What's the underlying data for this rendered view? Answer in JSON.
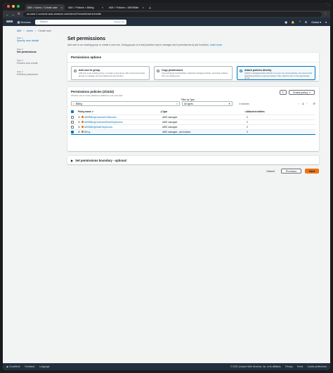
{
  "browser": {
    "tabs": [
      {
        "label": "IAM > Users > Create user",
        "active": true
      },
      {
        "label": "IAM > Policies > Billing",
        "active": false
      },
      {
        "label": "IAM > Policies > AWSBillin",
        "active": false
      }
    ],
    "url": "us-east-1.console.aws.amazon.com/iamv2/home#/users/create"
  },
  "aws_nav": {
    "services": "Services",
    "search_placeholder": "Search",
    "search_shortcut": "[Option+S]",
    "global": "Global",
    "account": "▾"
  },
  "breadcrumb": [
    "IAM",
    "Users",
    "Create user"
  ],
  "steps": [
    {
      "num": "Step 1",
      "label": "Specify user details",
      "state": "done"
    },
    {
      "num": "Step 2",
      "label": "Set permissions",
      "state": "current"
    },
    {
      "num": "Step 3",
      "label": "Review and create",
      "state": "disabled"
    },
    {
      "num": "Step 4",
      "label": "Retrieve password",
      "state": "disabled"
    }
  ],
  "page": {
    "title": "Set permissions",
    "description": "Add user to an existing group or create a new one. Using groups is a best-practice way to manage user's permissions by job functions.",
    "learn_more": "Learn more"
  },
  "permission_options": {
    "title": "Permissions options",
    "options": [
      {
        "title": "Add user to group",
        "desc": "Add user to an existing group, or create a new group. We recommend using groups to manage user permissions by job function.",
        "selected": false
      },
      {
        "title": "Copy permissions",
        "desc": "Copy all group memberships, attached managed policies, and inline policies from an existing user.",
        "selected": false
      },
      {
        "title": "Attach policies directly",
        "desc": "Attach a managed policy directly to a user. As a best practice, we recommend attaching policies to a group instead. Then, add the user to the appropriate group.",
        "selected": true
      }
    ]
  },
  "policies": {
    "title": "Permissions policies (2/1102)",
    "subtitle": "Choose one or more policies to attach to your new user.",
    "refresh_icon": "↻",
    "create_label": "Create policy",
    "filter_by_type_label": "Filter by Type",
    "search_value": "Billing",
    "type_value": "All types",
    "matches": "4 matches",
    "page": "1",
    "columns": [
      "Policy name",
      "Type",
      "Attached entities"
    ],
    "rows": [
      {
        "name": "AWSBillingConductorFullAccess",
        "type": "AWS managed",
        "entities": "0",
        "checked": false
      },
      {
        "name": "AWSBillingConductorReadOnlyAccess",
        "type": "AWS managed",
        "entities": "0",
        "checked": false
      },
      {
        "name": "AWSBillingReadOnlyAccess",
        "type": "AWS managed",
        "entities": "0",
        "checked": false
      },
      {
        "name": "Billing",
        "type": "AWS managed - job function",
        "entities": "0",
        "checked": true
      }
    ]
  },
  "boundary": {
    "label": "Set permissions boundary - optional"
  },
  "actions": {
    "cancel": "Cancel",
    "previous": "Previous",
    "next": "Next"
  },
  "footer": {
    "items": [
      "CloudShell",
      "Feedback",
      "Language"
    ],
    "copyright": "© 2023, Amazon Web Services, Inc. or its affiliates.",
    "links": [
      "Privacy",
      "Terms",
      "Cookie preferences"
    ]
  }
}
